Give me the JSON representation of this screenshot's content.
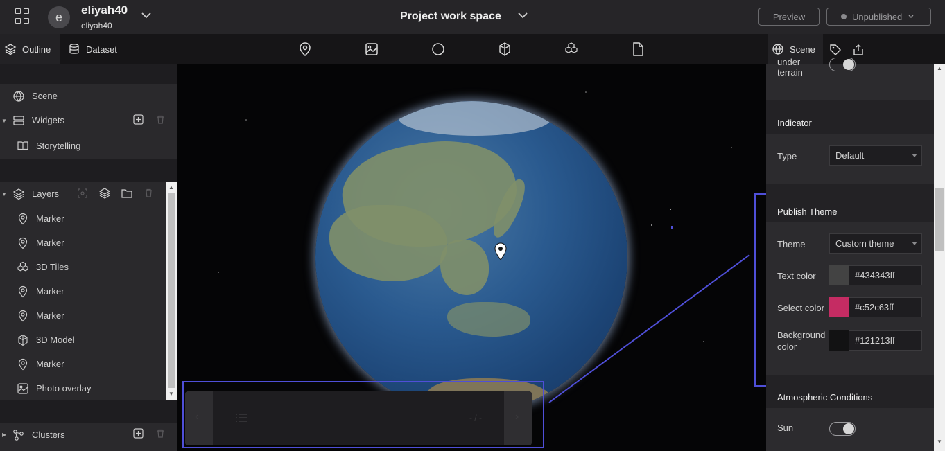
{
  "header": {
    "workspace_initial": "e",
    "workspace_name": "eliyah40",
    "workspace_sub": "eliyah40",
    "project_title": "Project work space",
    "preview_label": "Preview",
    "publish_status": "Unpublished"
  },
  "left_tabs": [
    {
      "label": "Outline",
      "icon": "layers-icon"
    },
    {
      "label": "Dataset",
      "icon": "database-icon"
    }
  ],
  "tools": [
    "marker-icon",
    "image-icon",
    "circle-icon",
    "model-icon",
    "tiles-icon",
    "file-icon"
  ],
  "outline": {
    "scene_label": "Scene",
    "widgets_label": "Widgets",
    "widgets_items": [
      {
        "label": "Storytelling",
        "icon": "book-icon"
      }
    ],
    "layers_label": "Layers",
    "layers_items": [
      {
        "label": "Marker",
        "icon": "marker-icon"
      },
      {
        "label": "Marker",
        "icon": "marker-icon"
      },
      {
        "label": "3D Tiles",
        "icon": "tiles-icon"
      },
      {
        "label": "Marker",
        "icon": "marker-icon"
      },
      {
        "label": "Marker",
        "icon": "marker-icon"
      },
      {
        "label": "3D Model",
        "icon": "model-icon"
      },
      {
        "label": "Marker",
        "icon": "marker-icon"
      },
      {
        "label": "Photo overlay",
        "icon": "image-icon"
      }
    ],
    "clusters_label": "Clusters"
  },
  "story": {
    "page_indicator": "- / -"
  },
  "right_tabs": {
    "scene_label": "Scene"
  },
  "right_panel": {
    "terrain_label_line1": "under",
    "terrain_label_line2": "terrain",
    "indicator": {
      "title": "Indicator",
      "type_label": "Type",
      "type_value": "Default"
    },
    "publish_theme": {
      "title": "Publish Theme",
      "theme_label": "Theme",
      "theme_value": "Custom theme",
      "text_color_label": "Text color",
      "text_color_value": "#434343ff",
      "text_color_hex": "#434343",
      "select_color_label": "Select color",
      "select_color_value": "#c52c63ff",
      "select_color_hex": "#c52c63",
      "bg_color_label_line1": "Background",
      "bg_color_label_line2": "color",
      "bg_color_value": "#121213ff",
      "bg_color_hex": "#121213"
    },
    "atmosphere": {
      "title": "Atmospheric Conditions",
      "sun_label": "Sun",
      "sun_on": true
    }
  },
  "colors": {
    "highlight": "#4f4fd8",
    "accent_dark": "#232225"
  }
}
